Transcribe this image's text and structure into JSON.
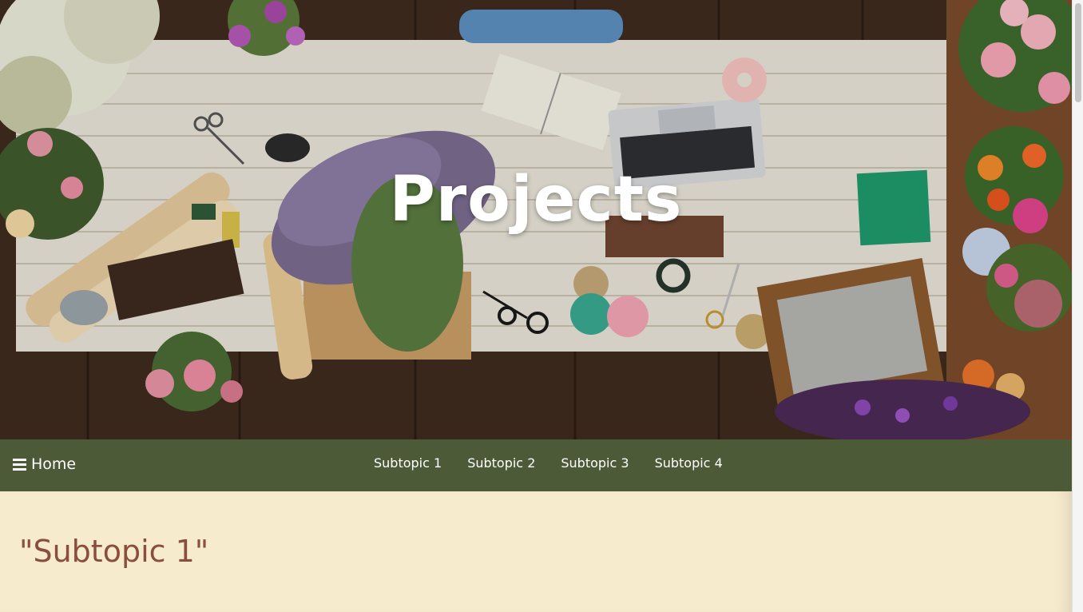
{
  "hero": {
    "title": "Projects"
  },
  "nav": {
    "home_label": "Home",
    "home_icon": "menu-icon",
    "links": [
      {
        "label": "Subtopic 1"
      },
      {
        "label": "Subtopic 2"
      },
      {
        "label": "Subtopic 3"
      },
      {
        "label": "Subtopic 4"
      }
    ]
  },
  "content": {
    "section_title": "\"Subtopic 1\""
  },
  "colors": {
    "nav_background": "#4c5a38",
    "content_background": "#f7ebce",
    "section_title": "#8a4f3c"
  }
}
